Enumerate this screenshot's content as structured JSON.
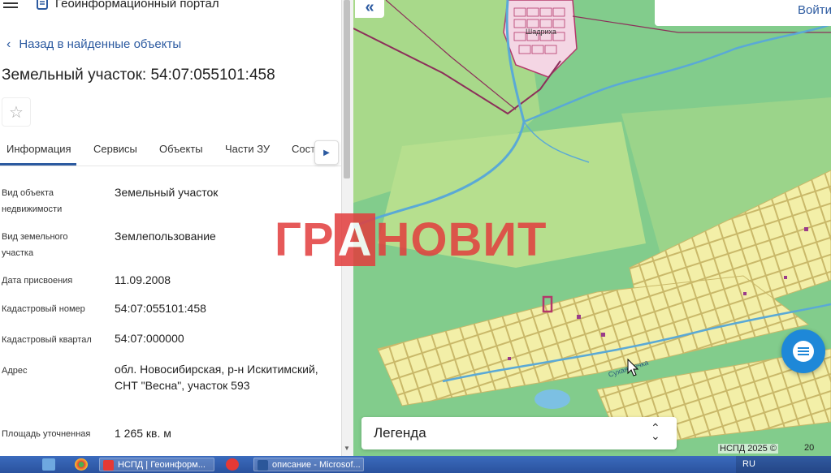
{
  "header": {
    "portal_title": "Геоинформационный портал"
  },
  "nav": {
    "back_label": "Назад в найденные объекты"
  },
  "parcel": {
    "title": "Земельный участок: 54:07:055101:458"
  },
  "tabs": [
    {
      "label": "Информация"
    },
    {
      "label": "Сервисы"
    },
    {
      "label": "Объекты"
    },
    {
      "label": "Части ЗУ"
    },
    {
      "label": "Сост"
    }
  ],
  "info_rows": [
    {
      "label": "Вид объекта недвижимости",
      "value": "Земельный участок"
    },
    {
      "label": "Вид земельного участка",
      "value": "Землепользование"
    },
    {
      "label": "Дата присвоения",
      "value": "11.09.2008"
    },
    {
      "label": "Кадастровый номер",
      "value": "54:07:055101:458"
    },
    {
      "label": "Кадастровый квартал",
      "value": "54:07:000000"
    },
    {
      "label": "Адрес",
      "value": "обл. Новосибирская, р-н Искитимский, СНТ \"Весна\", участок 593"
    },
    {
      "label": "Площадь уточненная",
      "value": "1 265 кв. м"
    }
  ],
  "map": {
    "login_label": "Войти",
    "legend_label": "Легенда",
    "attribution": "НСПД 2025 ©",
    "scale_label": "20",
    "river_label": "Сухая речка",
    "village_label": "Шадриха"
  },
  "watermark": {
    "pre": "ГР",
    "highlight": "А",
    "post": "НОВИТ"
  },
  "taskbar": {
    "tasks": [
      {
        "label": "НСПД | Геоинформ..."
      },
      {
        "label": "описание - Microsof..."
      }
    ],
    "lang": "RU"
  },
  "colors": {
    "accent": "#2c5aa0",
    "map_green": "#7fc98a",
    "plot_fill": "#f3efa8",
    "plot_border": "#c9b869",
    "river": "#5aa9d6",
    "taskbar": "#2f5ba8"
  }
}
